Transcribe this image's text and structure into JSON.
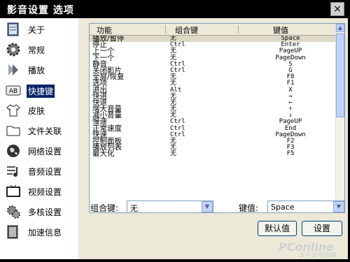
{
  "window": {
    "title": "影音设置 选项",
    "close_label": "×"
  },
  "sidebar": {
    "items": [
      {
        "label": "关于",
        "icon": "book-icon"
      },
      {
        "label": "常规",
        "icon": "gear-icon"
      },
      {
        "label": "播放",
        "icon": "play-arrow-icon"
      },
      {
        "label": "快捷键",
        "icon": "keyboard-ab-icon"
      },
      {
        "label": "皮肤",
        "icon": "tshirt-icon"
      },
      {
        "label": "文件关联",
        "icon": "folder-icon"
      },
      {
        "label": "网络设置",
        "icon": "globe-icon"
      },
      {
        "label": "音频设置",
        "icon": "audio-icon"
      },
      {
        "label": "视频设置",
        "icon": "tv-icon"
      },
      {
        "label": "多核设置",
        "icon": "multicore-icon"
      },
      {
        "label": "加速信息",
        "icon": "accelerate-icon"
      }
    ],
    "selected_index": 3
  },
  "table": {
    "headers": [
      "功能",
      "组合键",
      "键值"
    ],
    "rows": [
      [
        "播放/暂停",
        "无",
        "Space"
      ],
      [
        "停止",
        "Ctrl",
        "Enter"
      ],
      [
        "上一个",
        "无",
        "PageUP"
      ],
      [
        "下一个",
        "无",
        "PageDown"
      ],
      [
        "静音",
        "Ctrl",
        "S"
      ],
      [
        "关闭影片",
        "Ctrl",
        "G"
      ],
      [
        "全屏/恢复",
        "无",
        "F8"
      ],
      [
        "选项",
        "无",
        "F1"
      ],
      [
        "退出",
        "Alt",
        "X"
      ],
      [
        "快进",
        "无",
        "→"
      ],
      [
        "快退",
        "无",
        "←"
      ],
      [
        "增大音量",
        "无",
        "↑"
      ],
      [
        "减小音量",
        "无",
        "↓"
      ],
      [
        "慢速",
        "Ctrl",
        "PageUP"
      ],
      [
        "正常速度",
        "Ctrl",
        "End"
      ],
      [
        "快速",
        "Ctrl",
        "PageDown"
      ],
      [
        "控制面板",
        "无",
        "F2"
      ],
      [
        "播放列表",
        "无",
        "F3"
      ],
      [
        "最大化",
        "无",
        "F5"
      ]
    ]
  },
  "combo_key": {
    "label": "组合键:",
    "value": "无"
  },
  "key_value": {
    "label": "键值:",
    "value": "Space"
  },
  "buttons": {
    "default": "默认值",
    "set": "设置"
  },
  "watermark": {
    "line1": "PConline",
    "line2": "太平洋电脑网"
  }
}
